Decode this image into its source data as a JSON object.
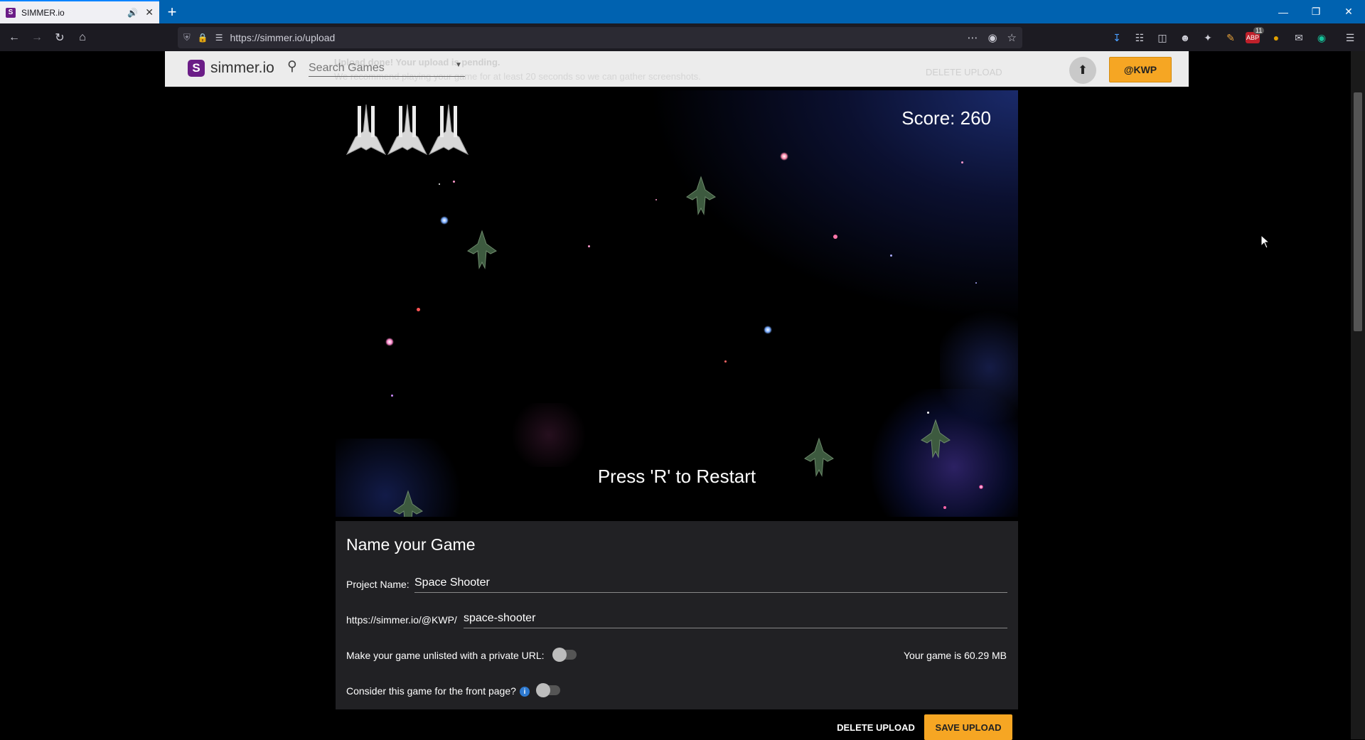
{
  "browser": {
    "tab_title": "SIMMER.io",
    "favicon_letter": "S",
    "url": "https://simmer.io/upload",
    "extension_badge": "11"
  },
  "site": {
    "logo_letter": "S",
    "logo_text": "simmer.io",
    "search_placeholder": "Search Games",
    "notice_line1": "Upload done! Your upload is pending.",
    "notice_line2": "We recommend playing your game for at least 20 seconds so we can gather screenshots.",
    "notice_delete": "DELETE UPLOAD",
    "user_label": "@KWP"
  },
  "game": {
    "score_text": "Score: 260",
    "restart_text": "Press 'R' to Restart",
    "lives": 3
  },
  "form": {
    "title": "Name your Game",
    "project_label": "Project Name:",
    "project_value": "Space Shooter",
    "url_prefix": "https://simmer.io/@KWP/",
    "url_value": "space-shooter",
    "unlisted_label": "Make your game unlisted with a private URL:",
    "unlisted_on": false,
    "size_text": "Your game is 60.29 MB",
    "frontpage_label": "Consider this game for the front page?",
    "frontpage_on": false,
    "delete_label": "DELETE UPLOAD",
    "save_label": "SAVE UPLOAD"
  },
  "colors": {
    "accent": "#f6a623",
    "brand": "#6b1d87",
    "titlebar": "#0062b0"
  }
}
